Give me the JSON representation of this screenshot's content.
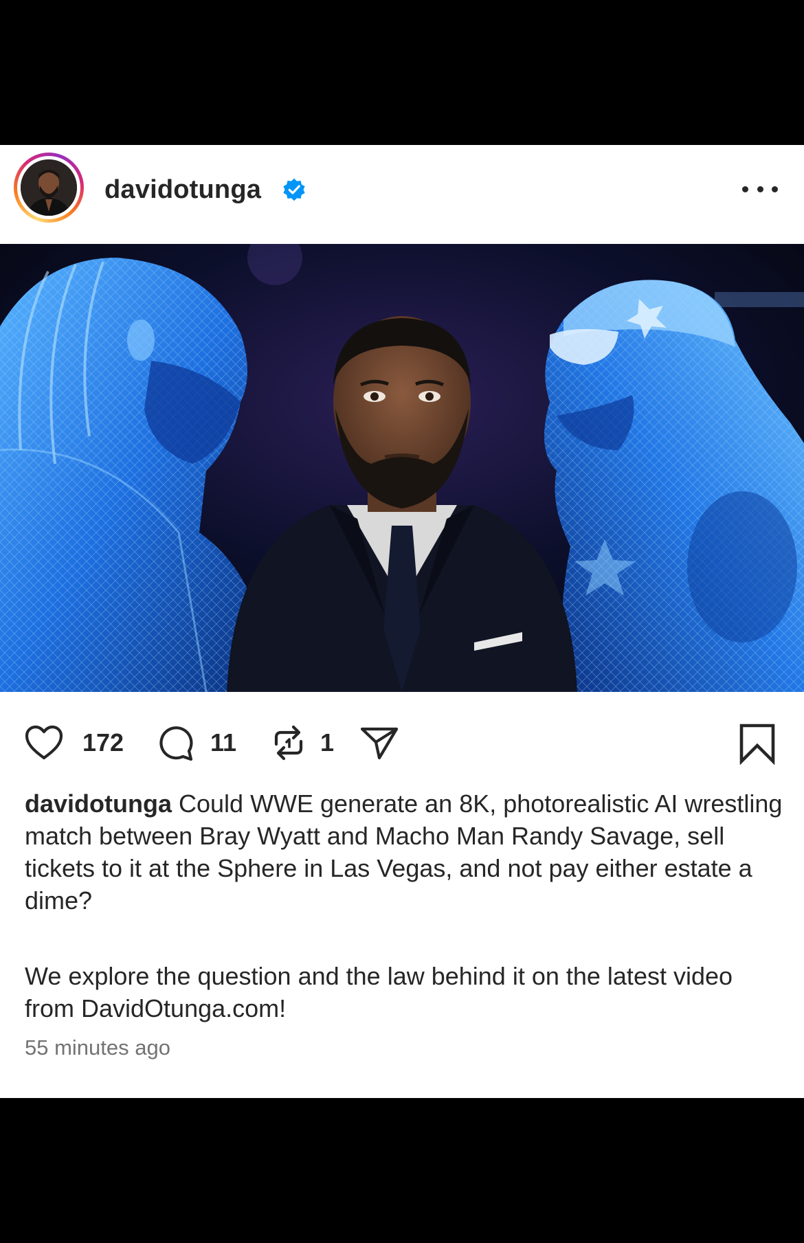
{
  "post": {
    "username": "davidotunga",
    "verified": true,
    "more_icon": "more-dots-icon",
    "image_alt": "Three men facing each other: two glowing blue holographic wrestlers flanking a man in a dark suit"
  },
  "actions": {
    "likes": "172",
    "comments": "11",
    "reposts": "1",
    "icons": [
      "heart-icon",
      "comment-icon",
      "repost-icon",
      "share-icon",
      "bookmark-icon"
    ]
  },
  "caption": {
    "username": "davidotunga",
    "text": " Could WWE generate an 8K, photorealistic AI wrestling match between Bray Wyatt and Macho Man Randy Savage, sell tickets to it at the Sphere in Las Vegas, and not pay either estate a dime?",
    "paragraph2": "We explore the question and the law behind it on the latest video from DavidOtunga.com!"
  },
  "timestamp": "55 minutes ago",
  "colors": {
    "verified_blue": "#0095f6",
    "text": "#262626",
    "muted": "#737373",
    "hologram_blue": "#2f8cff"
  }
}
